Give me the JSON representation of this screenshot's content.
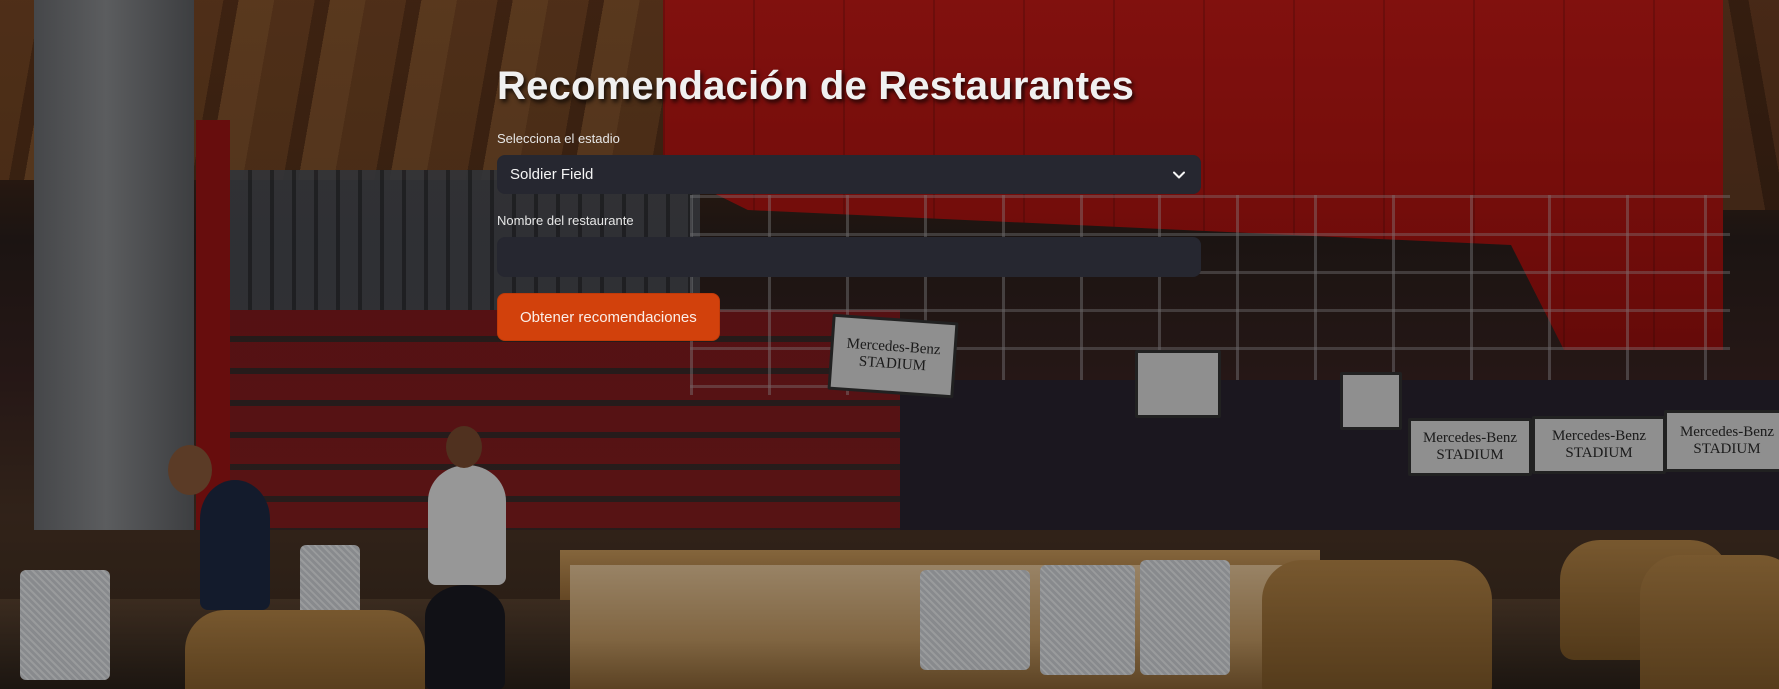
{
  "page": {
    "title": "Recomendación de Restaurantes"
  },
  "stadium_select": {
    "label": "Selecciona el estadio",
    "value": "Soldier Field",
    "icon": "chevron-down-icon"
  },
  "restaurant_input": {
    "label": "Nombre del restaurante",
    "value": "",
    "placeholder": ""
  },
  "submit_button": {
    "label": "Obtener recomendaciones",
    "color": "#d2410c"
  },
  "background": {
    "signs": [
      "Mercedes-Benz STADIUM",
      "Mercedes-Benz STADIUM",
      "Mercedes-Benz STADIUM",
      "Mercedes-Benz STADIUM"
    ]
  }
}
